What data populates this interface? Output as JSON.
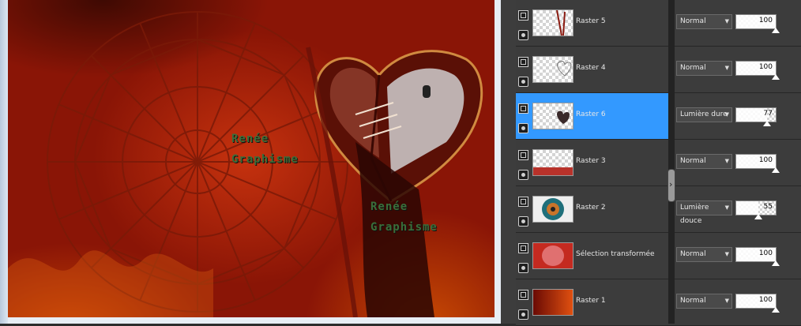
{
  "canvas": {
    "watermark_line1": "Renée",
    "watermark_line2": "Graphisme"
  },
  "layers": [
    {
      "name": "Raster 5",
      "blend": "Normal",
      "opacity": 100,
      "selected": false,
      "thumb": "strokes"
    },
    {
      "name": "Raster 4",
      "blend": "Normal",
      "opacity": 100,
      "selected": false,
      "thumb": "heart-outline"
    },
    {
      "name": "Raster 6",
      "blend": "Lumière dure",
      "opacity": 77,
      "selected": true,
      "thumb": "dark-heart"
    },
    {
      "name": "Raster 3",
      "blend": "Normal",
      "opacity": 100,
      "selected": false,
      "thumb": "bottom-band"
    },
    {
      "name": "Raster 2",
      "blend": "Lumière douce",
      "opacity": 55,
      "selected": false,
      "thumb": "mandala"
    },
    {
      "name": "Sélection transformée",
      "blend": "Normal",
      "opacity": 100,
      "selected": false,
      "thumb": "red-selection"
    },
    {
      "name": "Raster 1",
      "blend": "Normal",
      "opacity": 100,
      "selected": false,
      "thumb": "red-gradient"
    }
  ],
  "colors": {
    "selection": "#3399ff",
    "panel": "#3c3c3c",
    "canvas_red": "#b52a0b"
  }
}
